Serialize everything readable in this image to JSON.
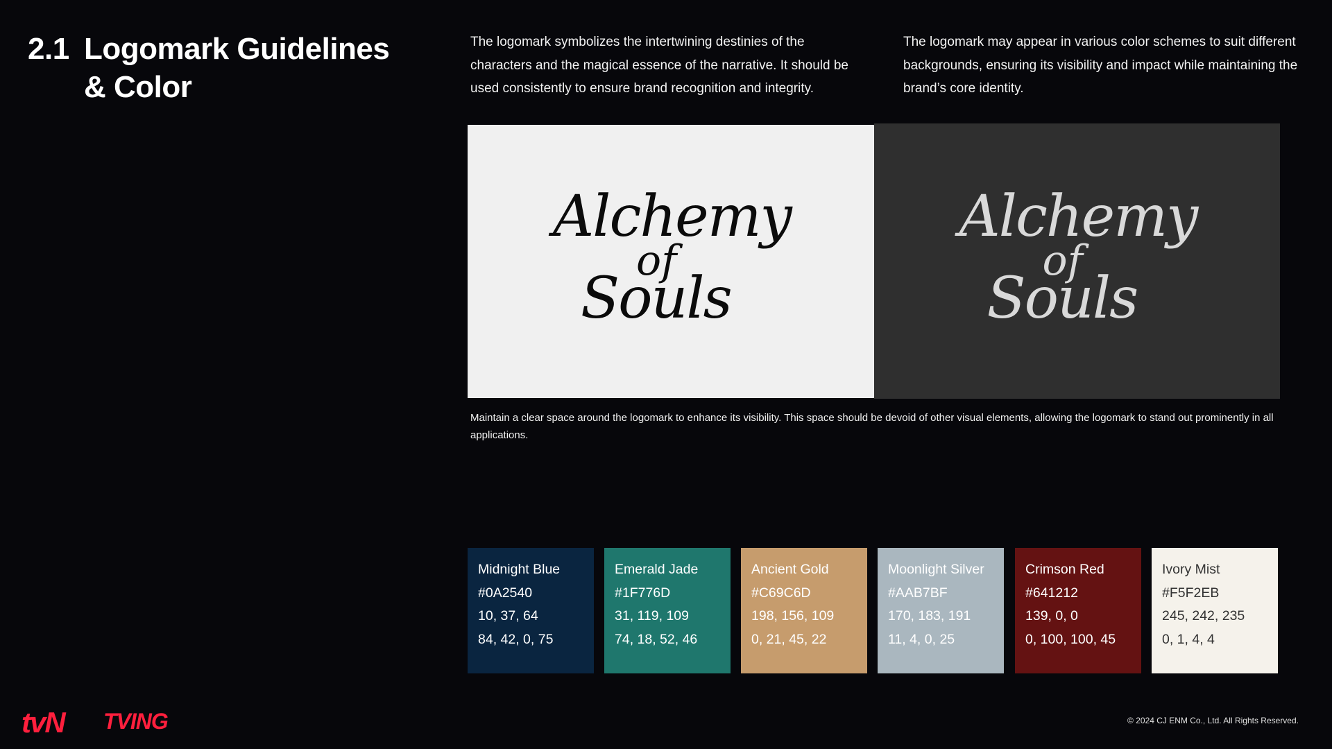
{
  "header": {
    "section_number": "2.1",
    "section_title": "Logomark Guidelines & Color"
  },
  "intro": {
    "left": "The logomark symbolizes the intertwining destinies of the characters and the magical essence of the narrative. It should be used consistently to ensure brand recognition and integrity.",
    "right": "The logomark may appear in various color schemes to suit different backgrounds, ensuring its visibility and impact while maintaining the brand’s core identity."
  },
  "logo": {
    "word1": "Alchemy",
    "word2": "of",
    "word3": "Souls",
    "panel_light_bg": "#F0F0F0",
    "panel_dark_bg": "#2F2F2F"
  },
  "clearspace_note": "Maintain a clear space around the logomark to enhance its visibility. This space should be devoid of other visual elements, allowing the logomark to stand out prominently in all applications.",
  "palette": [
    {
      "name": "Midnight Blue",
      "hex": "#0A2540",
      "rgb": "10, 37, 64",
      "cmyk": "84, 42, 0, 75",
      "text_color": "#ffffff"
    },
    {
      "name": "Emerald Jade",
      "hex": "#1F776D",
      "rgb": "31, 119, 109",
      "cmyk": "74, 18, 52, 46",
      "text_color": "#ffffff"
    },
    {
      "name": "Ancient Gold",
      "hex": "#C69C6D",
      "rgb": "198, 156, 109",
      "cmyk": "0, 21, 45, 22",
      "text_color": "#ffffff"
    },
    {
      "name": "Moonlight Silver",
      "hex": "#AAB7BF",
      "rgb": "170, 183, 191",
      "cmyk": "11, 4, 0, 25",
      "text_color": "#ffffff"
    },
    {
      "name": "Crimson Red",
      "hex": "#641212",
      "rgb": "139, 0, 0",
      "cmyk": "0, 100, 100, 45",
      "text_color": "#ffffff"
    },
    {
      "name": "Ivory Mist",
      "hex": "#F5F2EB",
      "rgb": "245, 242, 235",
      "cmyk": "0, 1, 4, 4",
      "text_color": "#333333"
    }
  ],
  "footer": {
    "brand1": "tvN",
    "brand2": "TVING",
    "brand_color": "#FF1F3D",
    "copyright": "© 2024 CJ ENM Co., Ltd. All Rights Reserved."
  }
}
